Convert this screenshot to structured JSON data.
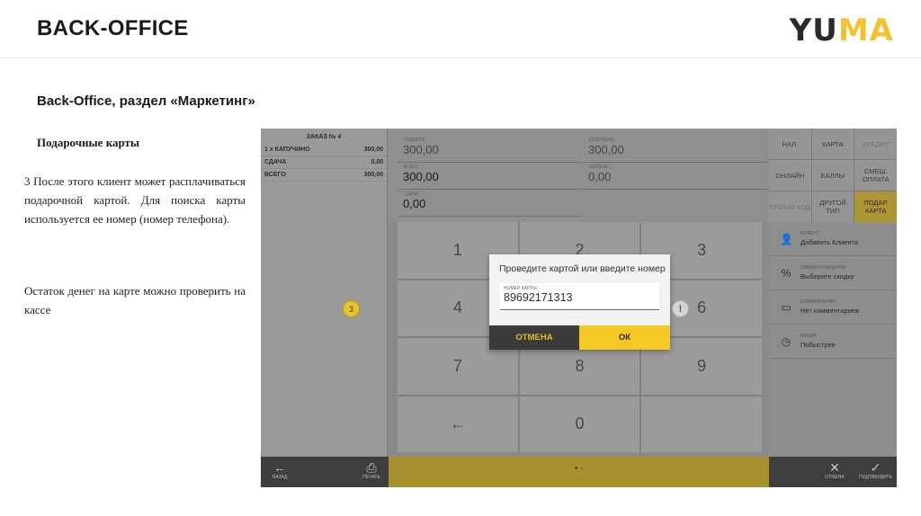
{
  "slide": {
    "title": "BACK-OFFICE",
    "logo_left": "YU",
    "logo_right": "MA",
    "section_title": "Back-Office, раздел «Маркетинг»",
    "subtitle": "Подарочные карты",
    "paragraph1": "3 После этого клиент может расплачиваться подарочной картой. Для поиска карты используется ее номер (номер телефона).",
    "paragraph2": "Остаток денег на карте можно проверить на кассе"
  },
  "colors": {
    "accent": "#f4c925",
    "dark": "#3b3b3b"
  },
  "pos": {
    "receipt": {
      "header": "ЗАКАЗ № 4",
      "rows": [
        {
          "label": "1 x КАПУЧИНО",
          "value": "300,00"
        },
        {
          "label": "СДАЧА",
          "value": "0,00"
        },
        {
          "label": "ВСЕГО",
          "value": "300,00"
        }
      ]
    },
    "amounts": {
      "topay": {
        "label": "ПОДЫТОГ",
        "value": "300,00"
      },
      "received": {
        "label": "ПОЛУЧЕНО",
        "value": "300,00"
      },
      "total": {
        "label": "ВСЕГО",
        "value": "300,00"
      },
      "tips": {
        "label": "ЧАЕВЫЕ",
        "value": "0,00"
      },
      "change": {
        "label": "СДАЧА",
        "value": "0,00"
      }
    },
    "keypad": [
      "1",
      "2",
      "3",
      "4",
      "5",
      "6",
      "7",
      "8",
      "9",
      "←",
      "0",
      ""
    ],
    "payment_methods": [
      {
        "label": "НАЛ.",
        "state": "normal"
      },
      {
        "label": "КАРТА",
        "state": "normal"
      },
      {
        "label": "КРЕДИТ",
        "state": "disabled"
      },
      {
        "label": "ОНЛАЙН",
        "state": "normal"
      },
      {
        "label": "БАЛЛЫ",
        "state": "normal"
      },
      {
        "label": "СМЕШ. ОПЛАТА",
        "state": "normal"
      },
      {
        "label": "ПРОМО КОД",
        "state": "disabled"
      },
      {
        "label": "ДРУГОЙ ТИП",
        "state": "normal"
      },
      {
        "label": "ПОДАР. КАРТА",
        "state": "active"
      }
    ],
    "info": [
      {
        "icon": "user-icon",
        "glyph": "👤",
        "label": "КЛИЕНТ",
        "value": "Добавить Клиента"
      },
      {
        "icon": "percent-icon",
        "glyph": "%",
        "label": "СКИДКИ И НАЦЕНКИ",
        "value": "Выберите скидку"
      },
      {
        "icon": "comment-icon",
        "glyph": "▭",
        "label": "КОММЕНТАРИИ",
        "value": "Нет комментариев"
      },
      {
        "icon": "clock-icon",
        "glyph": "◷",
        "label": "ВРЕМЯ",
        "value": "Побыстрее"
      }
    ],
    "bottom": {
      "back_label": "НАЗАД",
      "back_glyph": "←",
      "print_label": "ПЕЧАТЬ",
      "print_glyph": "⎙",
      "center_text": "• ·",
      "cancel_label": "ОТМЕНА",
      "cancel_glyph": "✕",
      "confirm_label": "ПОДТВЕРДИТЬ",
      "confirm_glyph": "✓"
    },
    "dialog": {
      "title": "Проведите картой или введите номер",
      "field_label": "НОМЕР КАРТЫ",
      "field_value": "89692171313",
      "cancel": "ОТМЕНА",
      "ok": "ОК"
    },
    "step_badge": "3",
    "exclamation": "!"
  }
}
